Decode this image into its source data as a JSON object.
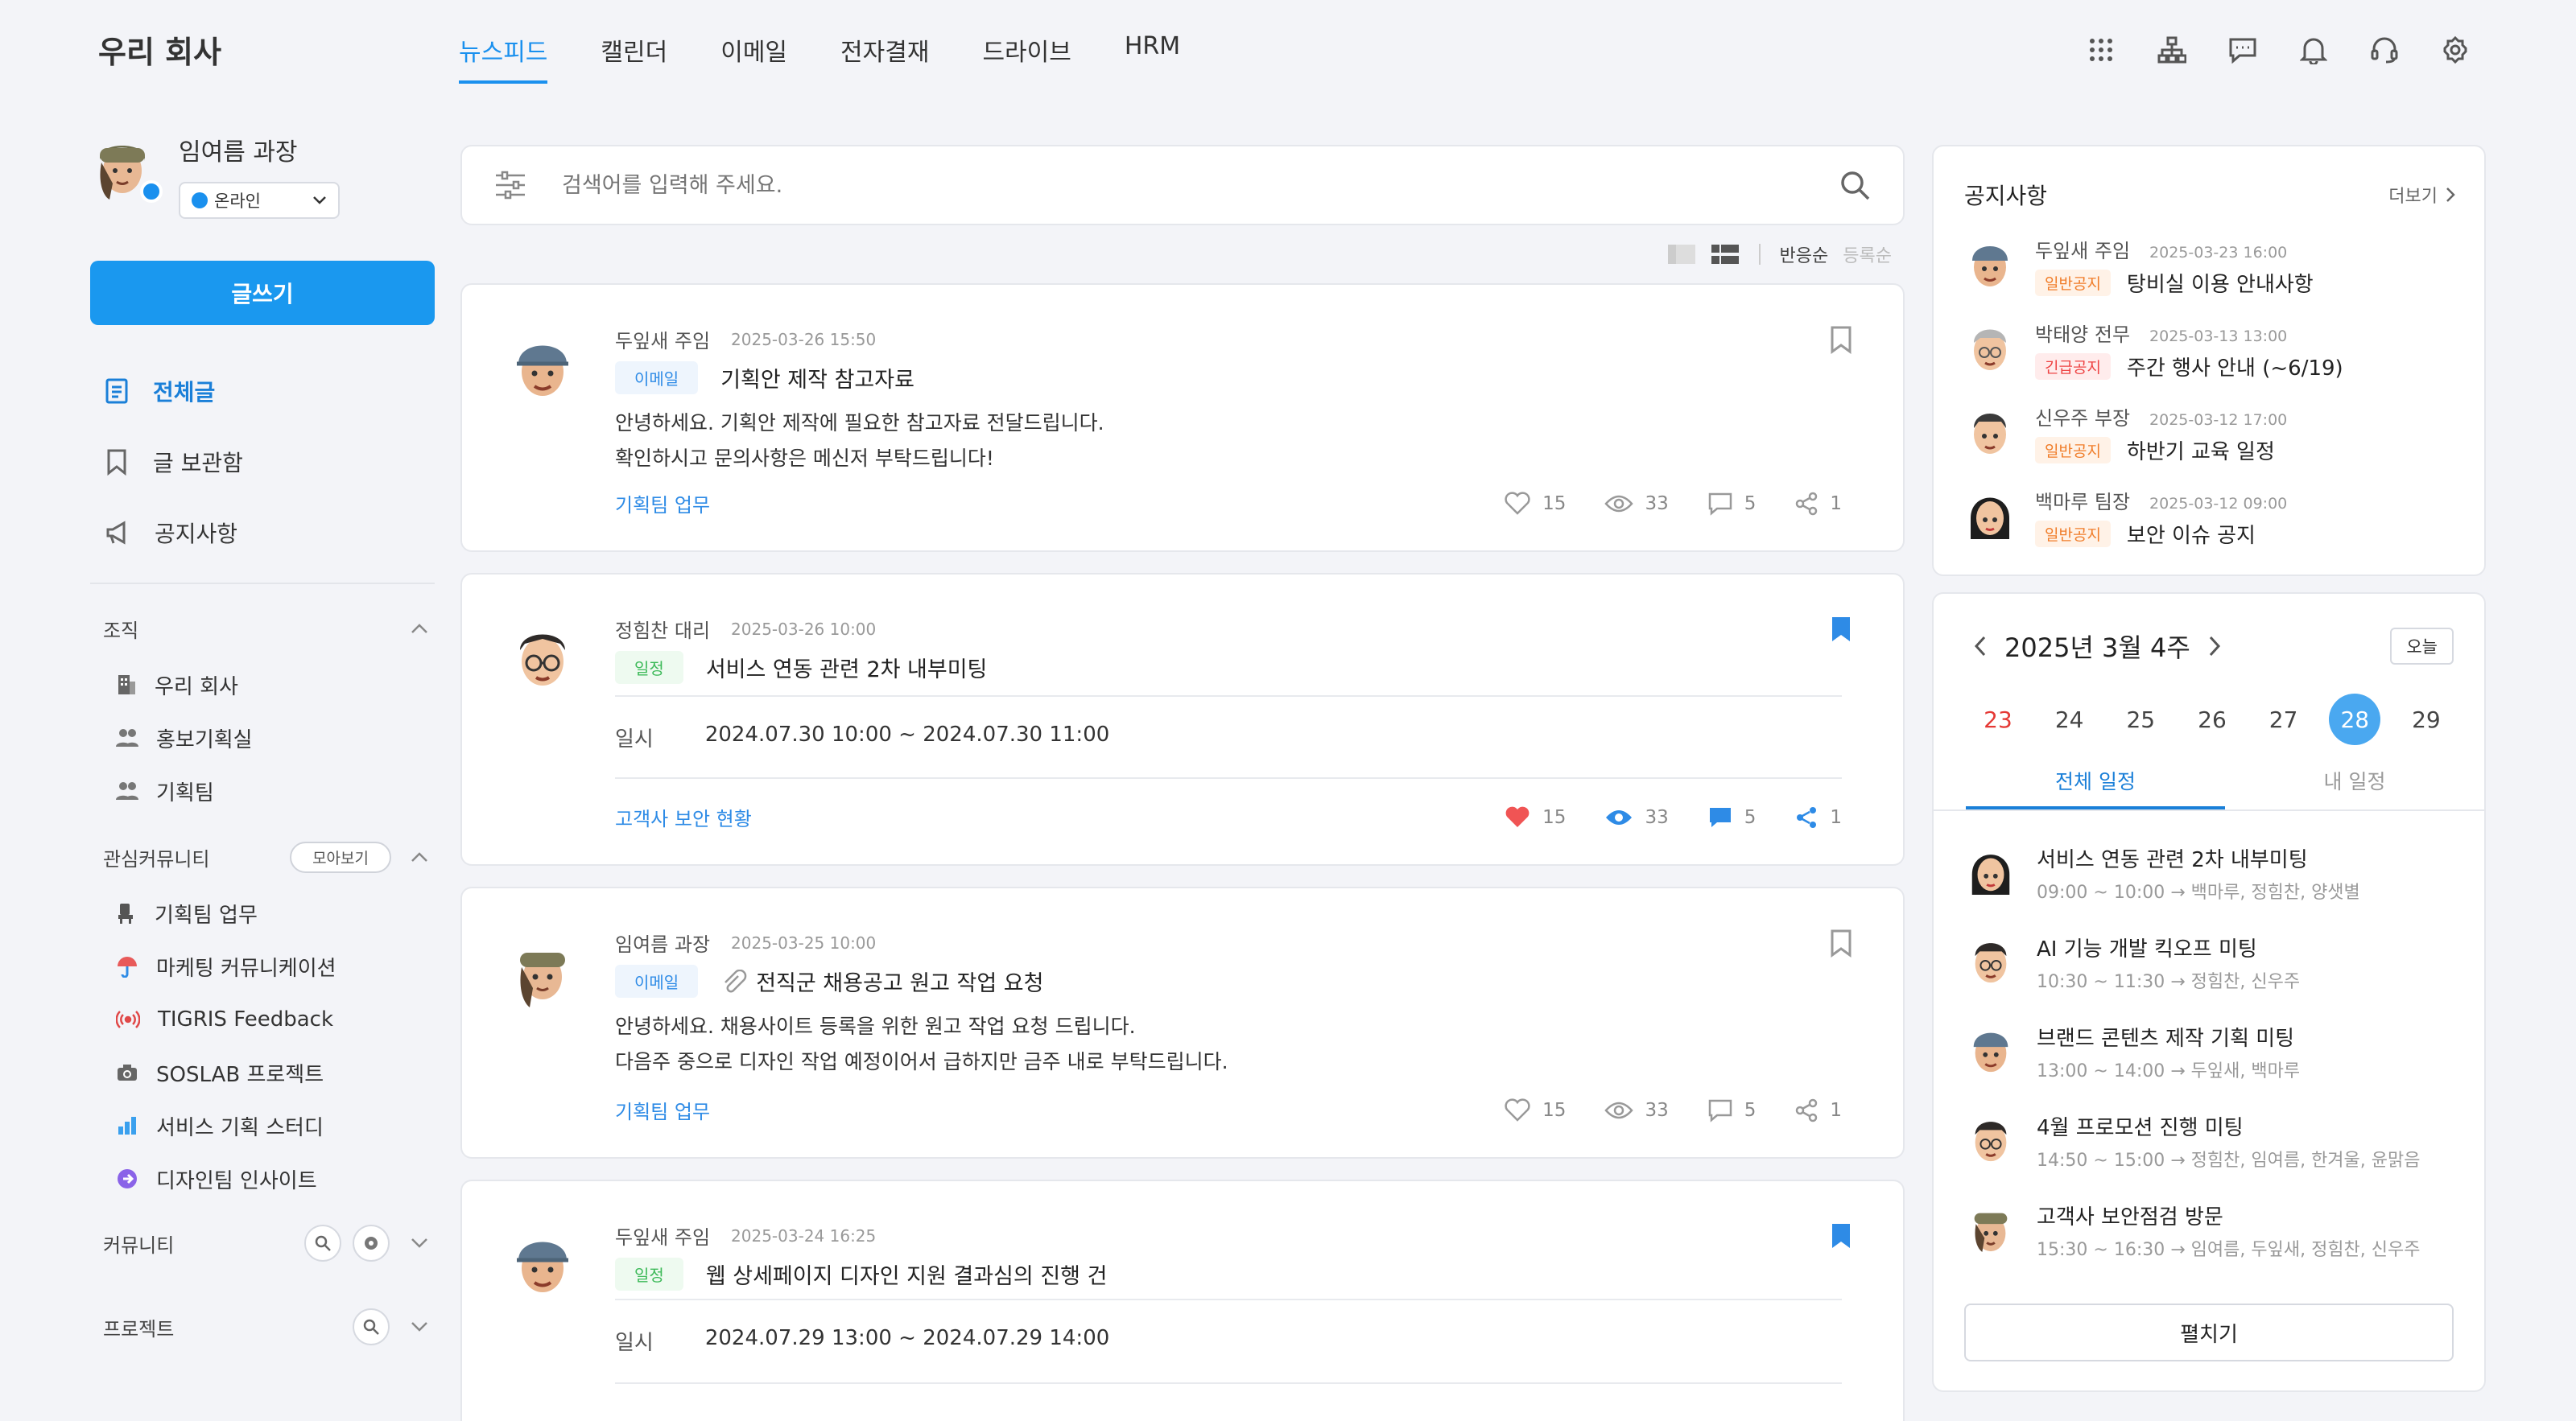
{
  "brand": "우리 회사",
  "gnb": [
    {
      "label": "뉴스피드"
    },
    {
      "label": "캘린더"
    },
    {
      "label": "이메일"
    },
    {
      "label": "전자결재"
    },
    {
      "label": "드라이브"
    },
    {
      "label": "HRM"
    }
  ],
  "top_icons": [
    "apps-grid-icon",
    "org-chart-icon",
    "chat-icon",
    "bell-icon",
    "headset-icon",
    "gear-icon"
  ],
  "profile": {
    "name": "임여름 과장",
    "status": "온라인"
  },
  "write_label": "글쓰기",
  "menu": [
    {
      "label": "전체글",
      "icon": "document-icon"
    },
    {
      "label": "글 보관함",
      "icon": "bookmark-icon"
    },
    {
      "label": "공지사항",
      "icon": "megaphone-icon"
    }
  ],
  "org": {
    "title": "조직",
    "items": [
      {
        "label": "우리 회사",
        "icon": "building-icon"
      },
      {
        "label": "홍보기획실",
        "icon": "people-icon"
      },
      {
        "label": "기획팀",
        "icon": "people-icon"
      }
    ]
  },
  "community": {
    "title": "관심커뮤니티",
    "pill": "모아보기",
    "items": [
      {
        "label": "기획팀 업무",
        "icon": "chair-icon"
      },
      {
        "label": "마케팅 커뮤니케이션",
        "icon": "umbrella-icon"
      },
      {
        "label": "TIGRIS Feedback",
        "icon": "broadcast-icon"
      },
      {
        "label": "SOSLAB 프로젝트",
        "icon": "camera-icon"
      },
      {
        "label": "서비스 기획 스터디",
        "icon": "bar-chart-icon"
      },
      {
        "label": "디자인팀 인사이트",
        "icon": "arrow-circle-icon"
      }
    ]
  },
  "community2": {
    "title": "커뮤니티"
  },
  "project": {
    "title": "프로젝트"
  },
  "search": {
    "placeholder": "검색어를 입력해 주세요."
  },
  "sort": {
    "by_reaction": "반응순",
    "by_date": "등록순"
  },
  "posts": [
    {
      "author": "두잎새 주임",
      "date": "2025-03-26 15:50",
      "tag": "이메일",
      "title": "기획안 제작 참고자료",
      "lines": [
        "안녕하세요. 기획안 제작에 필요한 참고자료 전달드립니다.",
        "확인하시고 문의사항은 메신저 부탁드립니다!"
      ],
      "category": "기획팀 업무",
      "likes": "15",
      "views": "33",
      "comments": "5",
      "shares": "1"
    },
    {
      "author": "정힘찬 대리",
      "date": "2025-03-26 10:00",
      "tag": "일정",
      "title": "서비스 연동 관련 2차 내부미팅",
      "when_label": "일시",
      "when": "2024.07.30 10:00 ~ 2024.07.30 11:00",
      "category": "고객사 보안 현황",
      "likes": "15",
      "views": "33",
      "comments": "5",
      "shares": "1"
    },
    {
      "author": "임여름 과장",
      "date": "2025-03-25 10:00",
      "tag": "이메일",
      "title": "전직군 채용공고 원고 작업 요청",
      "lines": [
        "안녕하세요. 채용사이트 등록을 위한 원고 작업 요청 드립니다.",
        "다음주 중으로 디자인 작업 예정이어서 급하지만 금주 내로 부탁드립니다."
      ],
      "category": "기획팀 업무",
      "likes": "15",
      "views": "33",
      "comments": "5",
      "shares": "1"
    },
    {
      "author": "두잎새 주임",
      "date": "2025-03-24 16:25",
      "tag": "일정",
      "title": "웹 상세페이지 디자인 지원 결과심의 진행 건",
      "when_label": "일시",
      "when": "2024.07.29 13:00 ~ 2024.07.29 14:00"
    }
  ],
  "notices": {
    "title": "공지사항",
    "more": "더보기",
    "items": [
      {
        "name": "두잎새 주임",
        "date": "2025-03-23 16:00",
        "tag": "일반공지",
        "title": "탕비실 이용 안내사항"
      },
      {
        "name": "박태양 전무",
        "date": "2025-03-13 13:00",
        "tag": "긴급공지",
        "title": "주간 행사 안내 (~6/19)"
      },
      {
        "name": "신우주 부장",
        "date": "2025-03-12 17:00",
        "tag": "일반공지",
        "title": "하반기 교육 일정"
      },
      {
        "name": "백마루 팀장",
        "date": "2025-03-12 09:00",
        "tag": "일반공지",
        "title": "보안 이슈 공지"
      }
    ]
  },
  "calendar": {
    "week": "2025년 3월 4주",
    "today": "오늘",
    "days": [
      "23",
      "24",
      "25",
      "26",
      "27",
      "28",
      "29"
    ],
    "selected": "28",
    "tabs": [
      "전체 일정",
      "내 일정"
    ],
    "events": [
      {
        "title": "서비스 연동 관련 2차 내부미팅",
        "time": "09:00 ~ 10:00",
        "people": "백마루, 정힘찬, 양샛별"
      },
      {
        "title": "AI 기능 개발 킥오프 미팅",
        "time": "10:30 ~ 11:30",
        "people": "정힘찬, 신우주"
      },
      {
        "title": "브랜드 콘텐츠 제작 기획 미팅",
        "time": "13:00 ~ 14:00",
        "people": "두잎새, 백마루"
      },
      {
        "title": "4월 프로모션 진행 미팅",
        "time": "14:50 ~ 15:00",
        "people": "정힘찬, 임여름, 한겨울, 윤맑음"
      },
      {
        "title": "고객사 보안점검 방문",
        "time": "15:30 ~ 16:30",
        "people": "임여름, 두잎새, 정힘찬, 신우주"
      }
    ],
    "expand": "펼치기"
  },
  "colors": {
    "accent": "#1a98ef",
    "like_red": "#f05454",
    "bookmark_blue": "#2e8be6"
  }
}
